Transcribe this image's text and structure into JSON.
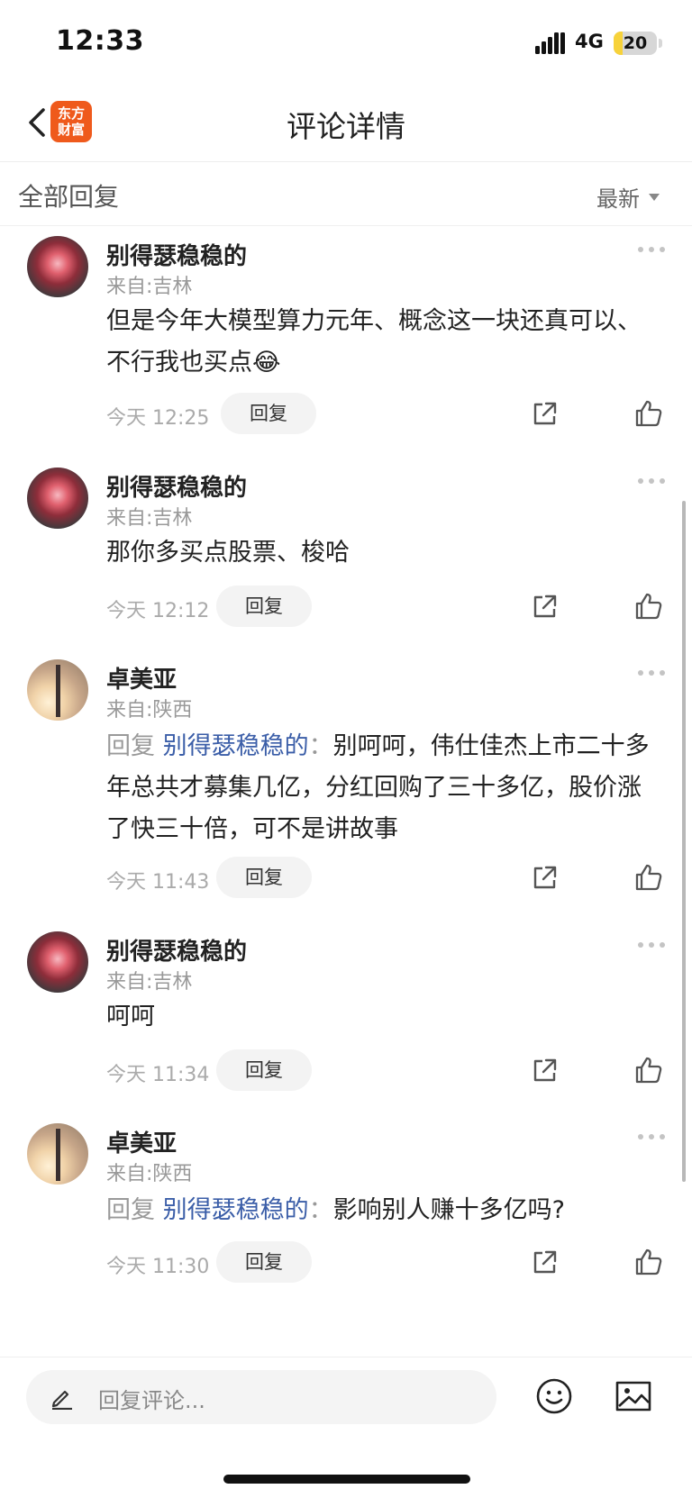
{
  "status_bar": {
    "time": "12:33",
    "network": "4G",
    "battery": "20",
    "battery_level": 0.2
  },
  "nav": {
    "logo_line1": "东方",
    "logo_line2": "财富",
    "title": "评论详情"
  },
  "filter": {
    "title": "全部回复",
    "sort_label": "最新"
  },
  "comments": [
    {
      "username": "别得瑟稳稳的",
      "location": "来自:吉林",
      "text": "但是今年大模型算力元年、概念这一块还真可以、不行我也买点",
      "emoji": "😂",
      "time": "今天 12:25",
      "reply_label": "回复",
      "avatar": "flower"
    },
    {
      "username": "别得瑟稳稳的",
      "location": "来自:吉林",
      "text": "那你多买点股票、梭哈",
      "time": "今天 12:12",
      "reply_label": "回复",
      "avatar": "flower"
    },
    {
      "username": "卓美亚",
      "location": "来自:陕西",
      "reply_prefix": "回复",
      "reply_target": "别得瑟稳稳的",
      "reply_colon": "：",
      "text": "别呵呵，伟仕佳杰上市二十多年总共才募集几亿，分红回购了三十多亿，股价涨了快三十倍，可不是讲故事",
      "time": "今天 11:43",
      "reply_label": "回复",
      "avatar": "tower"
    },
    {
      "username": "别得瑟稳稳的",
      "location": "来自:吉林",
      "text": "呵呵",
      "time": "今天 11:34",
      "reply_label": "回复",
      "avatar": "flower"
    },
    {
      "username": "卓美亚",
      "location": "来自:陕西",
      "reply_prefix": "回复",
      "reply_target": "别得瑟稳稳的",
      "reply_colon": "：",
      "text": "影响别人赚十多亿吗?",
      "time": "今天 11:30",
      "reply_label": "回复",
      "avatar": "tower"
    }
  ],
  "bottom_bar": {
    "placeholder": "回复评论..."
  },
  "icons": {
    "back": "back-chevron-icon",
    "more": "more-dots-icon",
    "share": "share-icon",
    "like": "thumbs-up-icon",
    "pen": "pen-icon",
    "emoji": "emoji-icon",
    "image": "image-icon"
  },
  "colors": {
    "accent": "#3b5ea8",
    "logo": "#ef5a1c",
    "battery": "#f7d23a"
  }
}
